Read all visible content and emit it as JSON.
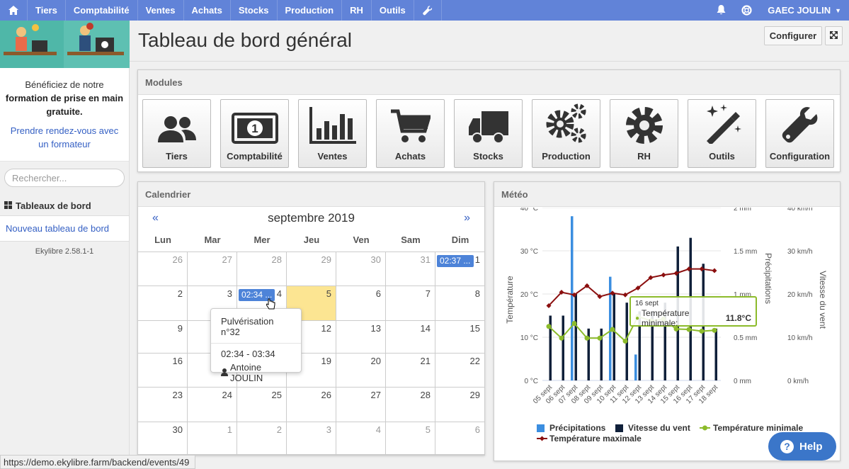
{
  "topnav": {
    "items": [
      "Tiers",
      "Comptabilité",
      "Ventes",
      "Achats",
      "Stocks",
      "Production",
      "RH",
      "Outils"
    ],
    "company": "GAEC JOULIN"
  },
  "sidebar": {
    "promo_line1": "Bénéficiez de notre",
    "promo_bold": "formation de prise en main gratuite",
    "promo_link": "Prendre rendez-vous avec un formateur",
    "search_placeholder": "Rechercher...",
    "section_title": "Tableaux de bord",
    "new_dashboard": "Nouveau tableau de bord",
    "version": "Ekylibre 2.58.1-1"
  },
  "page": {
    "title": "Tableau de bord général",
    "configure_label": "Configurer"
  },
  "modules": {
    "title": "Modules",
    "items": [
      "Tiers",
      "Comptabilité",
      "Ventes",
      "Achats",
      "Stocks",
      "Production",
      "RH",
      "Outils",
      "Configuration"
    ]
  },
  "calendar": {
    "title": "Calendrier",
    "prev": "«",
    "next": "»",
    "month": "septembre 2019",
    "days": [
      "Lun",
      "Mar",
      "Mer",
      "Jeu",
      "Ven",
      "Sam",
      "Dim"
    ],
    "weeks": [
      [
        "26",
        "27",
        "28",
        "29",
        "30",
        "31",
        "1"
      ],
      [
        "2",
        "3",
        "4",
        "5",
        "6",
        "7",
        "8"
      ],
      [
        "9",
        "10",
        "11",
        "12",
        "13",
        "14",
        "15"
      ],
      [
        "16",
        "17",
        "18",
        "19",
        "20",
        "21",
        "22"
      ],
      [
        "23",
        "24",
        "25",
        "26",
        "27",
        "28",
        "29"
      ],
      [
        "30",
        "1",
        "2",
        "3",
        "4",
        "5",
        "6"
      ]
    ],
    "event1": "02:37 ...",
    "event2": "02:34 ...",
    "popover": {
      "title": "Pulvérisation n°32",
      "time": "02:34 - 03:34",
      "person": "Antoine JOULIN"
    }
  },
  "weather": {
    "title": "Météo",
    "tooltip_date": "16 sept",
    "tooltip_label": "Température minimale:",
    "tooltip_value": "11.8°C"
  },
  "chart_data": {
    "type": "bar",
    "categories": [
      "05 sept",
      "06 sept",
      "07 sept",
      "08 sept",
      "09 sept",
      "10 sept",
      "11 sept",
      "12 sept",
      "13 sept",
      "14 sept",
      "15 sept",
      "16 sept",
      "17 sept",
      "18 sept"
    ],
    "left_axis": {
      "label": "Température",
      "ticks": [
        "0 °C",
        "10 °C",
        "20 °C",
        "30 °C",
        "40 °C"
      ],
      "ylim": [
        0,
        40
      ]
    },
    "right_axis_1": {
      "label": "Précipitations",
      "ticks": [
        "0 mm",
        "0.5 mm",
        "1 mm",
        "1.5 mm",
        "2 mm"
      ],
      "ylim": [
        0,
        2
      ]
    },
    "right_axis_2": {
      "label": "Vitesse du vent",
      "ticks": [
        "0 km/h",
        "10 km/h",
        "20 km/h",
        "30 km/h",
        "40 km/h"
      ],
      "ylim": [
        0,
        40
      ]
    },
    "series": [
      {
        "name": "Précipitations",
        "type": "bar",
        "color": "#3b8ee0",
        "values": [
          0,
          0,
          1.9,
          0,
          0,
          1.2,
          0,
          0.3,
          0,
          0,
          0,
          0,
          0,
          0
        ]
      },
      {
        "name": "Vitesse du vent",
        "type": "bar",
        "color": "#10203a",
        "values": [
          15,
          15,
          20,
          12,
          12,
          20,
          18,
          16,
          16,
          18,
          31,
          33,
          27,
          12
        ]
      },
      {
        "name": "Température minimale",
        "type": "line",
        "color": "#8cbb2a",
        "values": [
          12.5,
          9.8,
          13.2,
          9.8,
          9.8,
          11.8,
          9.1,
          14.8,
          13.8,
          14.2,
          11.9,
          11.8,
          11.4,
          11.6
        ]
      },
      {
        "name": "Température maximale",
        "type": "line",
        "color": "#8b0f0f",
        "values": [
          17.3,
          20.4,
          19.8,
          21.9,
          19.4,
          20.2,
          19.8,
          21.4,
          23.8,
          24.4,
          24.8,
          25.8,
          25.8,
          25.4
        ]
      }
    ],
    "legend": "bottom"
  },
  "status_url": "https://demo.ekylibre.farm/backend/events/49",
  "help_label": "Help"
}
